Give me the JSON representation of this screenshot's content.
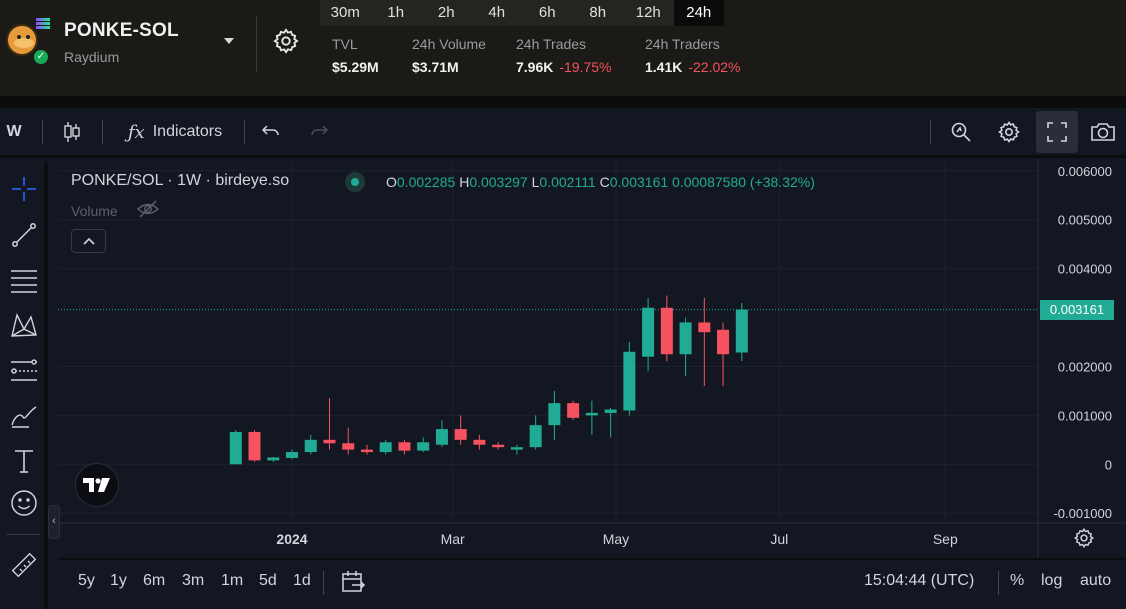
{
  "header": {
    "pair_name": "PONKE-SOL",
    "dex": "Raydium",
    "timeframes": [
      "30m",
      "1h",
      "2h",
      "4h",
      "6h",
      "8h",
      "12h",
      "24h"
    ],
    "active_timeframe": "24h",
    "stats": {
      "tvl": {
        "label": "TVL",
        "value": "$5.29M"
      },
      "volume": {
        "label": "24h Volume",
        "value": "$3.71M"
      },
      "trades": {
        "label": "24h Trades",
        "value": "7.96K",
        "change": "-19.75%"
      },
      "traders": {
        "label": "24h Traders",
        "value": "1.41K",
        "change": "-22.02%"
      }
    }
  },
  "toolbar": {
    "interval": "W",
    "indicators_label": "Indicators"
  },
  "legend": {
    "title": "PONKE/SOL · 1W · birdeye.so",
    "o_label": "O",
    "o": "0.002285",
    "h_label": "H",
    "h": "0.003297",
    "l_label": "L",
    "l": "0.002111",
    "c_label": "C",
    "c": "0.003161",
    "change": "0.00087580 (+38.32%)",
    "volume_label": "Volume"
  },
  "price_axis": {
    "ticks": [
      "0.006000",
      "0.005000",
      "0.004000",
      "0.002000",
      "0.001000",
      "0",
      "-0.001000"
    ],
    "last_price": "0.003161"
  },
  "time_axis": {
    "ticks": [
      "2024",
      "Mar",
      "May",
      "Jul",
      "Sep"
    ]
  },
  "bottom": {
    "ranges": [
      "5y",
      "1y",
      "6m",
      "3m",
      "1m",
      "5d",
      "1d"
    ],
    "clock": "15:04:44 (UTC)",
    "percent_label": "%",
    "log_label": "log",
    "auto_label": "auto"
  },
  "colors": {
    "up": "#22ab94",
    "down": "#f7525f",
    "background": "#131722"
  },
  "chart_data": {
    "type": "candlestick",
    "title": "PONKE/SOL · 1W · birdeye.so",
    "ylim": [
      -0.0012,
      0.0062
    ],
    "y_ticks": [
      0.006,
      0.005,
      0.004,
      0.002,
      0.001,
      0,
      -0.001
    ],
    "x_ticks": [
      {
        "label": "2024",
        "date": "2024-01-01"
      },
      {
        "label": "Mar",
        "date": "2024-03-01"
      },
      {
        "label": "May",
        "date": "2024-05-01"
      },
      {
        "label": "Jul",
        "date": "2024-07-01"
      },
      {
        "label": "Sep",
        "date": "2024-09-01"
      }
    ],
    "last_price": 0.003161,
    "candles": [
      {
        "date": "2023-12-11",
        "o": 0.0,
        "h": 0.0007,
        "l": 0.0,
        "c": 0.00066
      },
      {
        "date": "2023-12-18",
        "o": 0.00066,
        "h": 0.0007,
        "l": 5e-05,
        "c": 8e-05
      },
      {
        "date": "2023-12-25",
        "o": 8e-05,
        "h": 0.00015,
        "l": 5e-05,
        "c": 0.00014
      },
      {
        "date": "2024-01-01",
        "o": 0.00013,
        "h": 0.0003,
        "l": 0.0001,
        "c": 0.00025
      },
      {
        "date": "2024-01-08",
        "o": 0.00025,
        "h": 0.0006,
        "l": 0.0002,
        "c": 0.0005
      },
      {
        "date": "2024-01-15",
        "o": 0.0005,
        "h": 0.00135,
        "l": 0.0003,
        "c": 0.00043
      },
      {
        "date": "2024-01-22",
        "o": 0.00043,
        "h": 0.00075,
        "l": 0.0002,
        "c": 0.0003
      },
      {
        "date": "2024-01-29",
        "o": 0.0003,
        "h": 0.0004,
        "l": 0.0002,
        "c": 0.00025
      },
      {
        "date": "2024-02-05",
        "o": 0.00025,
        "h": 0.0005,
        "l": 0.0002,
        "c": 0.00045
      },
      {
        "date": "2024-02-12",
        "o": 0.00045,
        "h": 0.0005,
        "l": 0.0002,
        "c": 0.00028
      },
      {
        "date": "2024-02-19",
        "o": 0.00028,
        "h": 0.00055,
        "l": 0.00025,
        "c": 0.00045
      },
      {
        "date": "2024-02-26",
        "o": 0.0004,
        "h": 0.0009,
        "l": 0.00035,
        "c": 0.00072
      },
      {
        "date": "2024-03-04",
        "o": 0.00072,
        "h": 0.001,
        "l": 0.0004,
        "c": 0.0005
      },
      {
        "date": "2024-03-11",
        "o": 0.0005,
        "h": 0.0006,
        "l": 0.0003,
        "c": 0.0004
      },
      {
        "date": "2024-03-18",
        "o": 0.0004,
        "h": 0.00045,
        "l": 0.0003,
        "c": 0.00035
      },
      {
        "date": "2024-03-25",
        "o": 0.0003,
        "h": 0.0004,
        "l": 0.0002,
        "c": 0.00035
      },
      {
        "date": "2024-04-01",
        "o": 0.00035,
        "h": 0.001,
        "l": 0.0003,
        "c": 0.0008
      },
      {
        "date": "2024-04-08",
        "o": 0.0008,
        "h": 0.0015,
        "l": 0.0005,
        "c": 0.00125
      },
      {
        "date": "2024-04-15",
        "o": 0.00125,
        "h": 0.0013,
        "l": 0.0009,
        "c": 0.00095
      },
      {
        "date": "2024-04-22",
        "o": 0.001,
        "h": 0.0013,
        "l": 0.0006,
        "c": 0.00105
      },
      {
        "date": "2024-04-29",
        "o": 0.00105,
        "h": 0.00115,
        "l": 0.00055,
        "c": 0.00112
      },
      {
        "date": "2024-05-06",
        "o": 0.0011,
        "h": 0.0025,
        "l": 0.001,
        "c": 0.0023
      },
      {
        "date": "2024-05-13",
        "o": 0.0022,
        "h": 0.0034,
        "l": 0.0019,
        "c": 0.0032
      },
      {
        "date": "2024-05-20",
        "o": 0.0032,
        "h": 0.00345,
        "l": 0.0021,
        "c": 0.00225
      },
      {
        "date": "2024-05-27",
        "o": 0.00225,
        "h": 0.003,
        "l": 0.0018,
        "c": 0.0029
      },
      {
        "date": "2024-06-03",
        "o": 0.0029,
        "h": 0.0034,
        "l": 0.0016,
        "c": 0.0027
      },
      {
        "date": "2024-06-10",
        "o": 0.00275,
        "h": 0.0029,
        "l": 0.0016,
        "c": 0.00225
      },
      {
        "date": "2024-06-17",
        "o": 0.002285,
        "h": 0.003297,
        "l": 0.002111,
        "c": 0.003161
      }
    ]
  }
}
